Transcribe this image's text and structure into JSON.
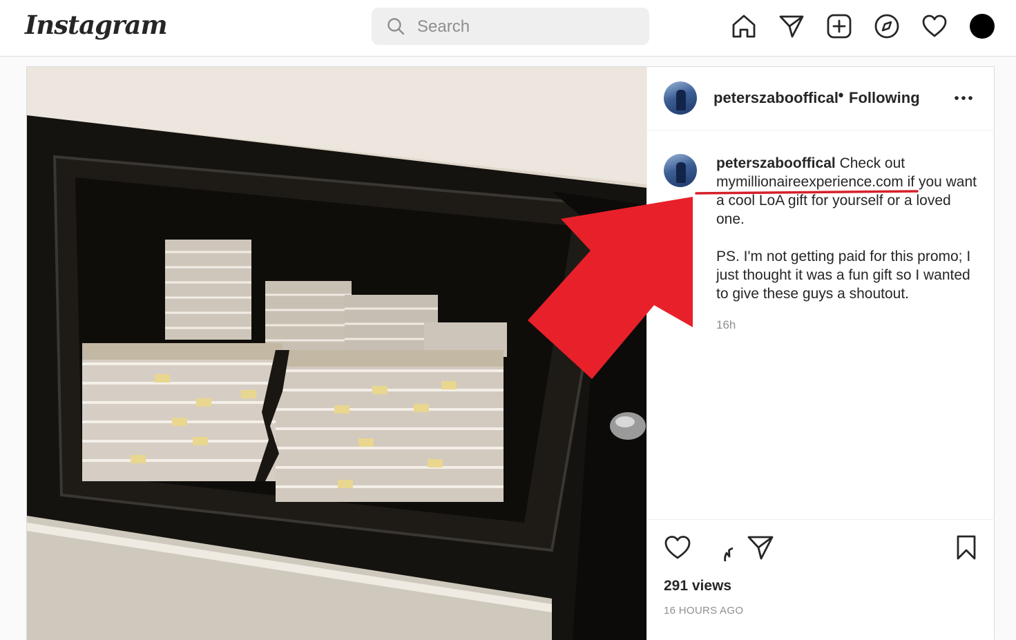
{
  "app": {
    "logo_text": "Instagram"
  },
  "search": {
    "placeholder": "Search",
    "icon": "search-icon"
  },
  "nav": {
    "icons": [
      "home-icon",
      "direct-message-icon",
      "new-post-icon",
      "explore-icon",
      "activity-heart-icon",
      "profile-avatar"
    ]
  },
  "post": {
    "author": "peterszabooffical",
    "follow_status": "Following",
    "separator": "•",
    "caption": {
      "username": "peterszabooffical",
      "lead": "Check out",
      "link": "mymillionaireexperience.com",
      "rest": "if you want a cool LoA gift for yourself or a loved one.",
      "ps": "PS. I'm not getting paid for this promo; I just thought it was a fun gift so I wanted to give these guys a shoutout."
    },
    "time_short": "16h",
    "views": "291 views",
    "time_long": "16 HOURS AGO",
    "media": {
      "subject": "open safe filled with stacks of banknotes"
    }
  },
  "annotation": {
    "arrow_color": "#e8202a",
    "underline_color": "#d6202a"
  }
}
